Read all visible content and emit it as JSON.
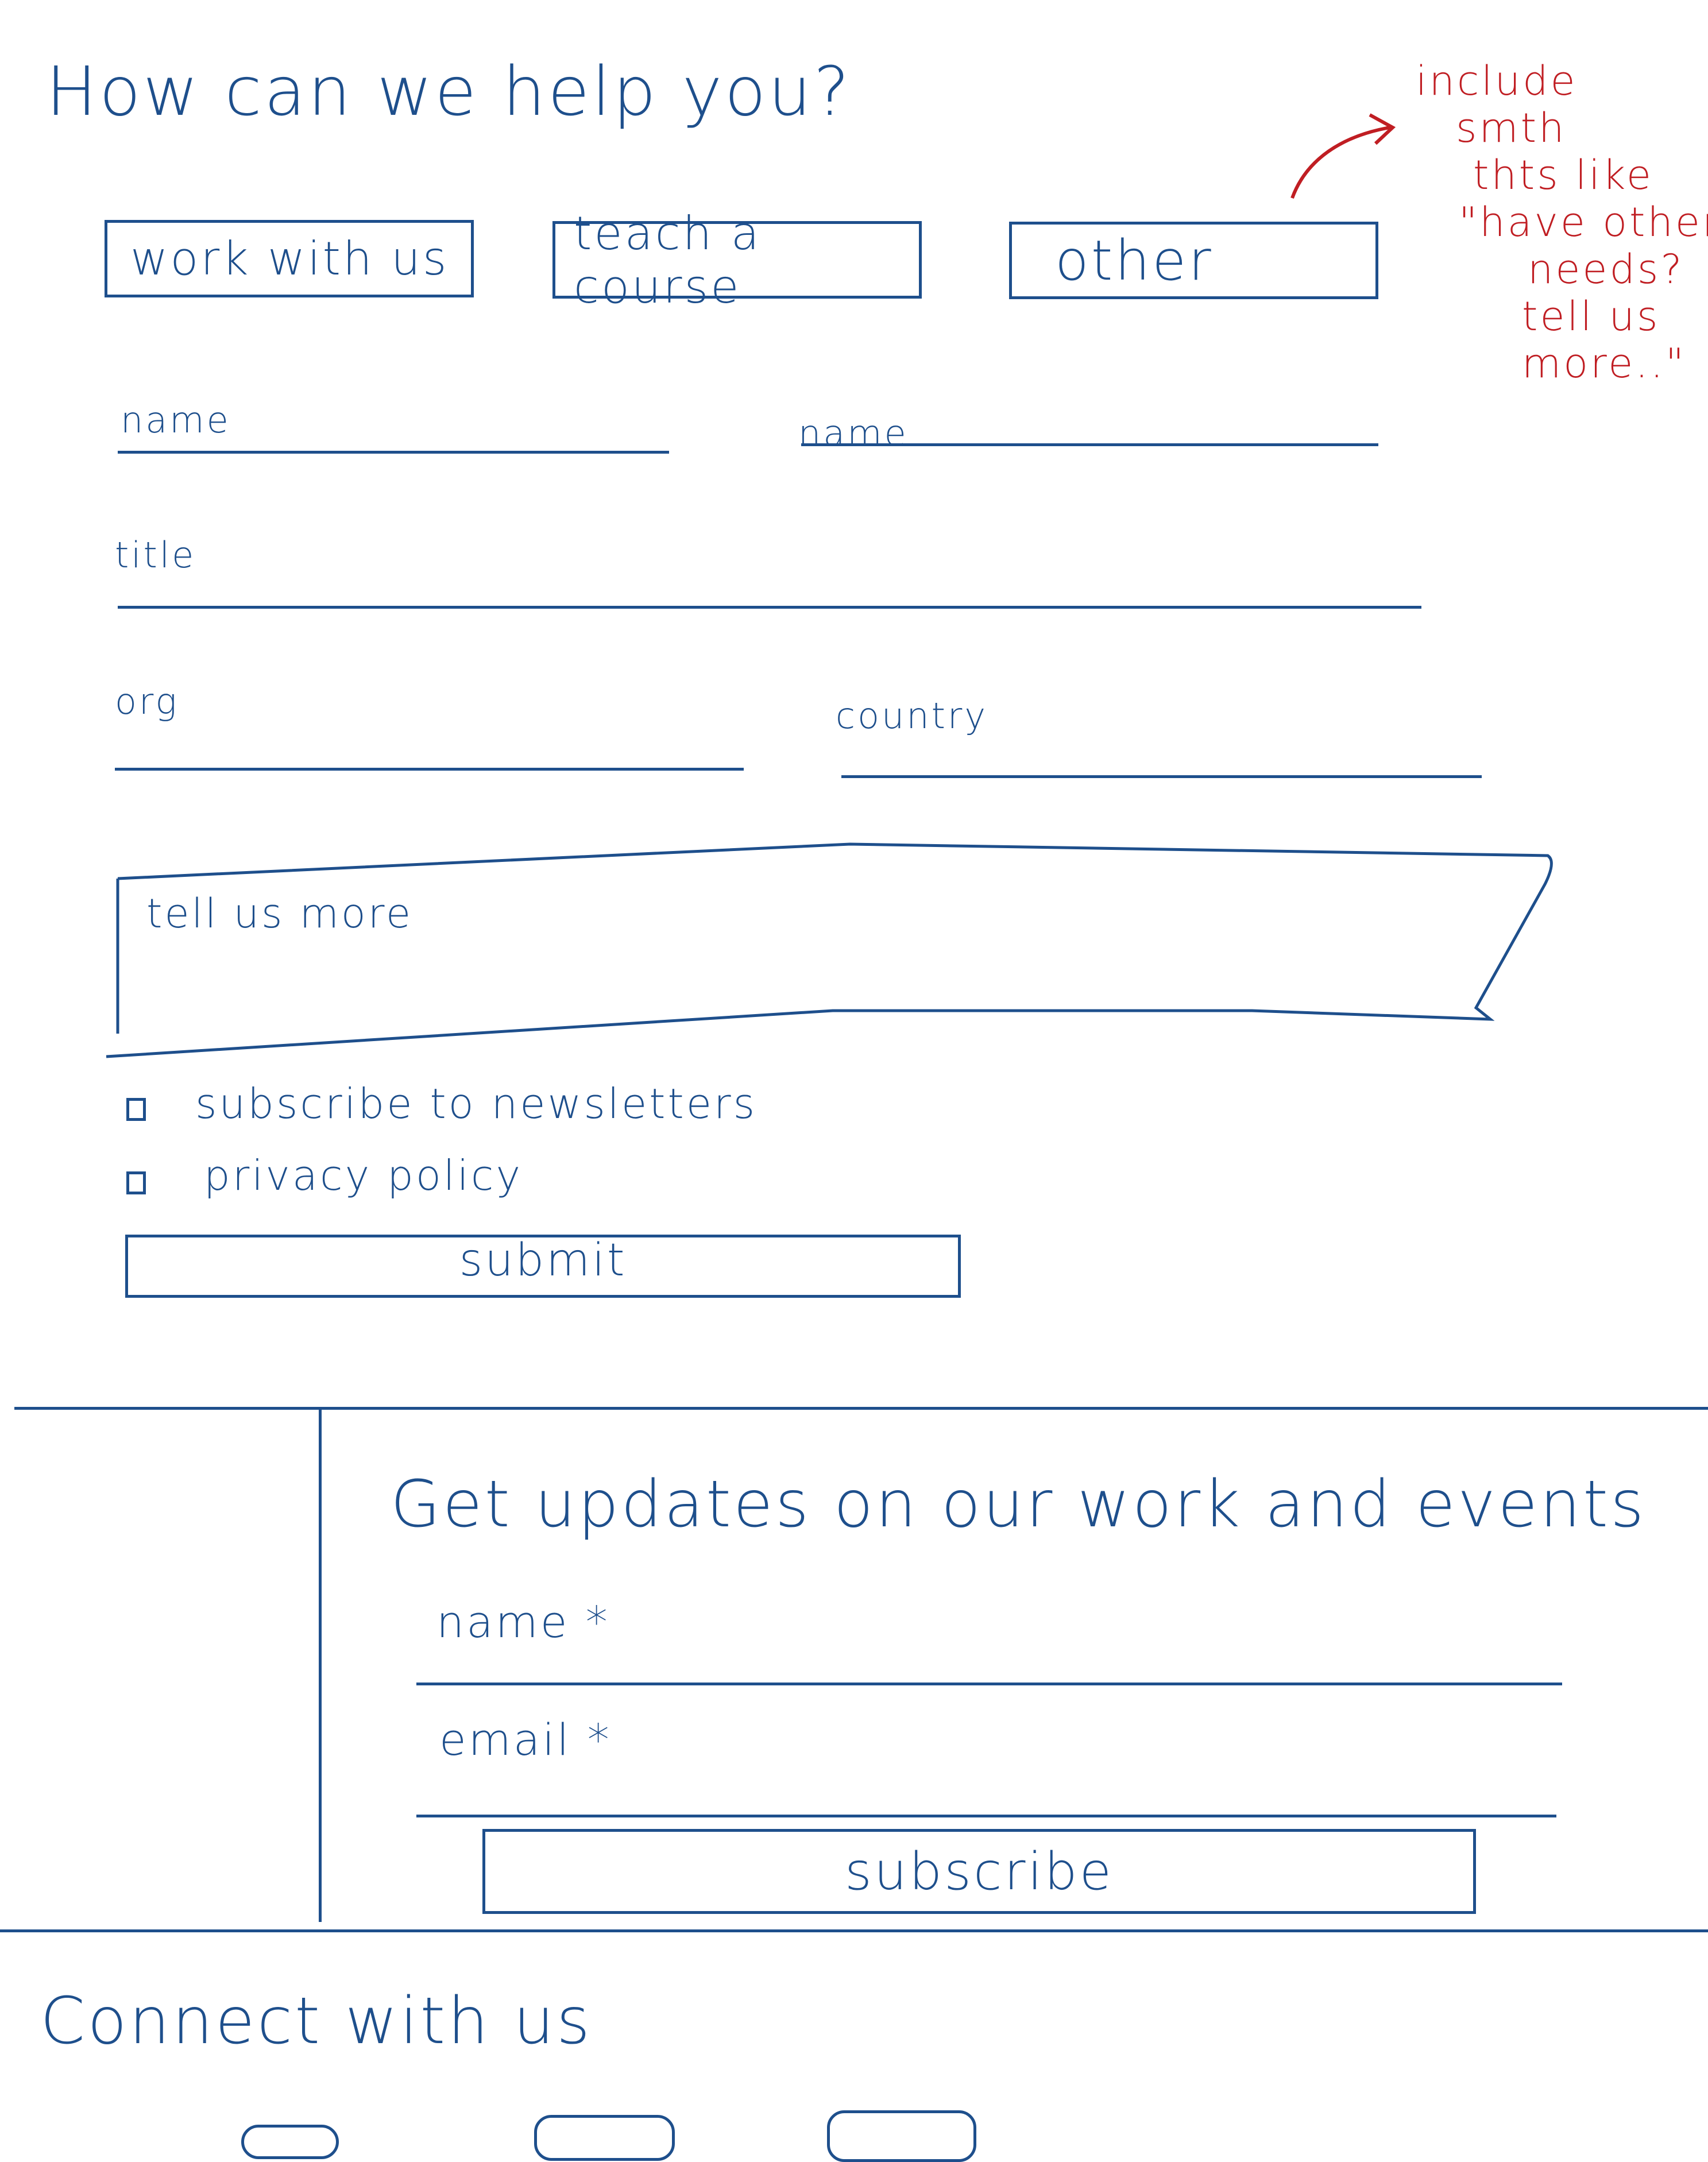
{
  "contact": {
    "heading": "How can we help you?",
    "options": [
      "work with us",
      "teach a course",
      "other"
    ],
    "note": {
      "lines": [
        "include",
        "smth",
        "thts like",
        "\"have other",
        "needs?",
        "tell us",
        "more..\""
      ]
    },
    "fields": {
      "name_1": "name",
      "name_2": "name",
      "title": "title",
      "org": "org",
      "country": "country"
    },
    "message_placeholder": "tell us more",
    "checkboxes": [
      "subscribe to newsletters",
      "privacy policy"
    ],
    "submit_label": "submit"
  },
  "newsletter": {
    "heading": "Get updates on our work and events",
    "name_label": "name *",
    "email_label": "email *",
    "subscribe_label": "subscribe"
  },
  "connect": {
    "heading": "Connect with us"
  },
  "colors": {
    "ink": "#1e4f8c",
    "note": "#c01e23"
  }
}
